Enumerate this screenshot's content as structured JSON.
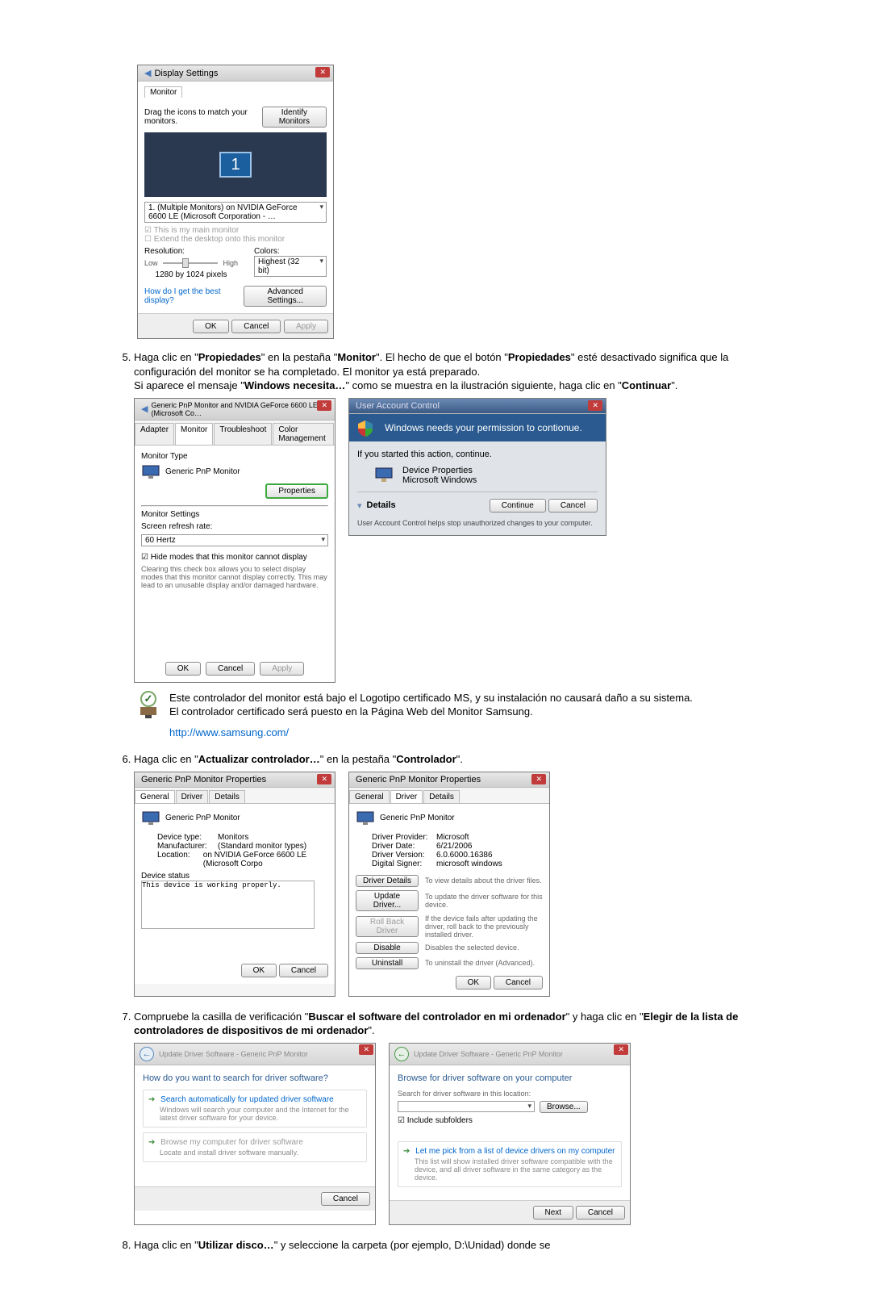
{
  "displaySettings": {
    "title": "Display Settings",
    "tab": "Monitor",
    "instruction": "Drag the icons to match your monitors.",
    "identify": "Identify Monitors",
    "monitorNumber": "1",
    "dropdown": "1. (Multiple Monitors) on NVIDIA GeForce 6600 LE (Microsoft Corporation - …",
    "mainMonitor": "This is my main monitor",
    "extend": "Extend the desktop onto this monitor",
    "resolutionLabel": "Resolution:",
    "low": "Low",
    "high": "High",
    "resolutionValue": "1280 by 1024 pixels",
    "colorsLabel": "Colors:",
    "colorsValue": "Highest (32 bit)",
    "bestDisplay": "How do I get the best display?",
    "advanced": "Advanced Settings...",
    "ok": "OK",
    "cancel": "Cancel",
    "apply": "Apply"
  },
  "step5": {
    "text1a": "Haga clic en \"",
    "propiedades": "Propiedades",
    "text1b": "\" en la pestaña \"",
    "monitor": "Monitor",
    "text1c": "\". El hecho de que el botón \"",
    "text1d": "\" esté desactivado significa que la configuración del monitor se ha completado. El monitor ya está preparado.",
    "text2a": "Si aparece el mensaje \"",
    "windowsNeeds": "Windows necesita…",
    "text2b": "\" como se muestra en la ilustración siguiente, haga clic en  \"",
    "continuar": "Continuar",
    "text2c": "\"."
  },
  "monitorProps": {
    "title": "Generic PnP Monitor and NVIDIA GeForce 6600 LE (Microsoft Co…",
    "tabs": {
      "adapter": "Adapter",
      "monitor": "Monitor",
      "troubleshoot": "Troubleshoot",
      "color": "Color Management"
    },
    "monitorType": "Monitor Type",
    "monitorName": "Generic PnP Monitor",
    "propertiesBtn": "Properties",
    "monitorSettings": "Monitor Settings",
    "refreshLabel": "Screen refresh rate:",
    "refreshValue": "60 Hertz",
    "hideModes": "Hide modes that this monitor cannot display",
    "hideModesDesc": "Clearing this check box allows you to select display modes that this monitor cannot display correctly. This may lead to an unusable display and/or damaged hardware.",
    "ok": "OK",
    "cancel": "Cancel",
    "apply": "Apply"
  },
  "uac": {
    "title": "User Account Control",
    "headline": "Windows needs your permission to contionue.",
    "ifStarted": "If you started this action, continue.",
    "deviceProps": "Device Properties",
    "msWindows": "Microsoft Windows",
    "details": "Details",
    "continue": "Continue",
    "cancel": "Cancel",
    "footer": "User Account Control helps stop unauthorized changes to your computer."
  },
  "note": {
    "line1": "Este controlador del monitor está bajo el Logotipo certificado MS, y su instalación no causará daño a su sistema.",
    "line2": "El controlador certificado será puesto en la Página Web del Monitor Samsung.",
    "link": "http://www.samsung.com/"
  },
  "step6": {
    "text1a": "Haga clic en \"",
    "actualizar": "Actualizar controlador…",
    "text1b": "\" en la pestaña \"",
    "controlador": "Controlador",
    "text1c": "\"."
  },
  "pnpGeneral": {
    "title": "Generic PnP Monitor Properties",
    "tabs": {
      "general": "General",
      "driver": "Driver",
      "details": "Details"
    },
    "name": "Generic PnP Monitor",
    "deviceTypeLabel": "Device type:",
    "deviceType": "Monitors",
    "manufacturerLabel": "Manufacturer:",
    "manufacturer": "(Standard monitor types)",
    "locationLabel": "Location:",
    "location": "on NVIDIA GeForce 6600 LE (Microsoft Corpo",
    "deviceStatusLabel": "Device status",
    "deviceStatus": "This device is working properly.",
    "ok": "OK",
    "cancel": "Cancel"
  },
  "pnpDriver": {
    "title": "Generic PnP Monitor Properties",
    "name": "Generic PnP Monitor",
    "providerLabel": "Driver Provider:",
    "provider": "Microsoft",
    "dateLabel": "Driver Date:",
    "date": "6/21/2006",
    "versionLabel": "Driver Version:",
    "version": "6.0.6000.16386",
    "signerLabel": "Digital Signer:",
    "signer": "microsoft windows",
    "detailsBtn": "Driver Details",
    "detailsDesc": "To view details about the driver files.",
    "updateBtn": "Update Driver...",
    "updateDesc": "To update the driver software for this device.",
    "rollbackBtn": "Roll Back Driver",
    "rollbackDesc": "If the device fails after updating the driver, roll back to the previously installed driver.",
    "disableBtn": "Disable",
    "disableDesc": "Disables the selected device.",
    "uninstallBtn": "Uninstall",
    "uninstallDesc": "To uninstall the driver (Advanced).",
    "ok": "OK",
    "cancel": "Cancel"
  },
  "step7": {
    "text1a": "Compruebe la casilla de verificación \"",
    "buscar": "Buscar el software del controlador en mi ordenador",
    "text1b": "\" y haga clic en \"",
    "elegir": "Elegir de la lista de controladores de dispositivos de mi ordenador",
    "text1c": "\"."
  },
  "wizard1": {
    "title": "Update Driver Software - Generic PnP Monitor",
    "heading": "How do you want to search for driver software?",
    "opt1": "Search automatically for updated driver software",
    "opt1sub": "Windows will search your computer and the Internet for the latest driver software for your device.",
    "opt2": "Browse my computer for driver software",
    "opt2sub": "Locate and install driver software manually.",
    "cancel": "Cancel"
  },
  "wizard2": {
    "title": "Update Driver Software - Generic PnP Monitor",
    "heading": "Browse for driver software on your computer",
    "searchLabel": "Search for driver software in this location:",
    "browse": "Browse...",
    "include": "Include subfolders",
    "pick": "Let me pick from a list of device drivers on my computer",
    "pickSub": "This list will show installed driver software compatible with the device, and all driver software in the same category as the device.",
    "next": "Next",
    "cancel": "Cancel"
  },
  "step8": {
    "text1a": "Haga clic en \"",
    "utilizar": "Utilizar disco…",
    "text1b": "\" y seleccione la carpeta (por ejemplo, D:\\Unidad) donde se"
  }
}
